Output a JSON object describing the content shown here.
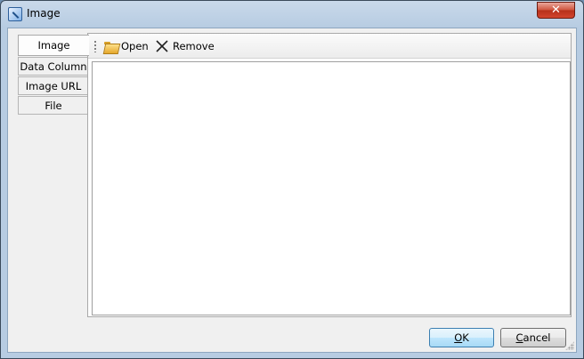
{
  "window": {
    "title": "Image",
    "close_symbol": "✕"
  },
  "tabs": [
    {
      "label": "Image",
      "active": true
    },
    {
      "label": "Data Column",
      "active": false
    },
    {
      "label": "Image URL",
      "active": false
    },
    {
      "label": "File",
      "active": false
    }
  ],
  "toolbar": {
    "open_label": "Open",
    "open_icon": "folder-open-icon",
    "remove_label": "Remove",
    "remove_icon": "x-icon"
  },
  "dialog_buttons": {
    "ok_label": "OK",
    "cancel_label": "Cancel"
  },
  "colors": {
    "title_bar": "#b7cce2",
    "close_button": "#c84a35",
    "ok_button_border": "#3c7fb1",
    "panel_background": "#ffffff"
  }
}
